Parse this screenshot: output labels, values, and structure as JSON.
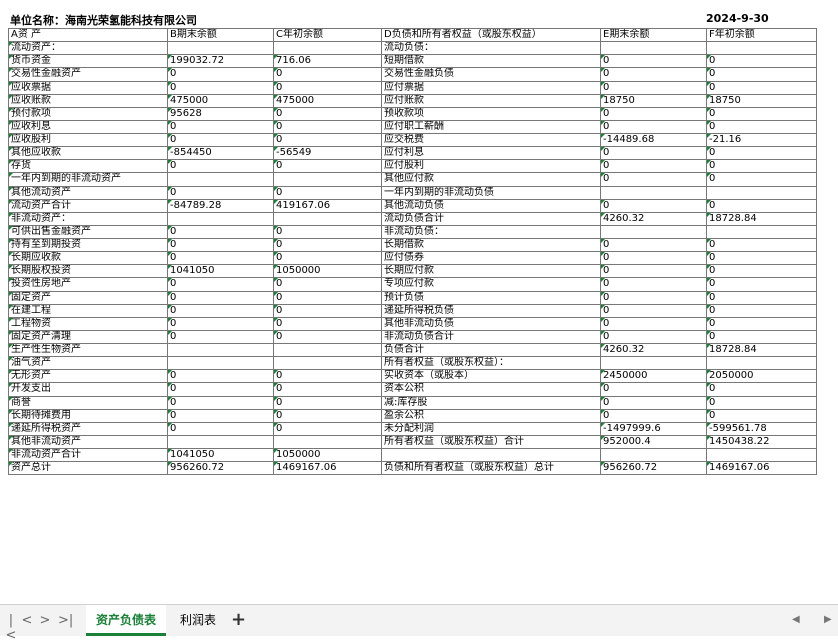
{
  "sheet": {
    "company": "单位名称：海南光荣氢能科技有限公司",
    "date": "2024-9-30",
    "columns": [
      "A资  产",
      "B期末余额",
      "C年初余额",
      "D负债和所有者权益（或股东权益）",
      "E期末余额",
      "F年初余额"
    ],
    "rows": [
      [
        "流动资产：",
        "",
        "",
        "流动负债：",
        "",
        ""
      ],
      [
        "  货币资金",
        "199032.72",
        "716.06",
        "  短期借款",
        "0",
        "0"
      ],
      [
        "  交易性金融资产",
        "0",
        "0",
        "  交易性金融负债",
        "0",
        "0"
      ],
      [
        "  应收票据",
        "0",
        "0",
        "  应付票据",
        "0",
        "0"
      ],
      [
        "  应收账款",
        "475000",
        "475000",
        "  应付账款",
        "18750",
        "18750"
      ],
      [
        "  预付款项",
        "95628",
        "0",
        "  预收款项",
        "0",
        "0"
      ],
      [
        "  应收利息",
        "0",
        "0",
        "  应付职工薪酬",
        "0",
        "0"
      ],
      [
        "  应收股利",
        "0",
        "0",
        "  应交税费",
        "-14489.68",
        "-21.16"
      ],
      [
        "  其他应收款",
        "-854450",
        "-56549",
        "  应付利息",
        "0",
        "0"
      ],
      [
        "  存货",
        "0",
        "0",
        "  应付股利",
        "0",
        "0"
      ],
      [
        "  一年内到期的非流动资产",
        "",
        "",
        "  其他应付款",
        "0",
        "0"
      ],
      [
        "  其他流动资产",
        "0",
        "0",
        "  一年内到期的非流动负债",
        "",
        ""
      ],
      [
        "    流动资产合计",
        "-84789.28",
        "419167.06",
        "  其他流动负债",
        "0",
        "0"
      ],
      [
        "非流动资产：",
        "",
        "",
        "  流动负债合计",
        "4260.32",
        "18728.84"
      ],
      [
        "  可供出售金融资产",
        "0",
        "0",
        "非流动负债：",
        "",
        ""
      ],
      [
        "  持有至到期投资",
        "0",
        "0",
        "  长期借款",
        "0",
        "0"
      ],
      [
        "  长期应收款",
        "0",
        "0",
        "  应付债券",
        "0",
        "0"
      ],
      [
        "  长期股权投资",
        "1041050",
        "1050000",
        "  长期应付款",
        "0",
        "0"
      ],
      [
        "  投资性房地产",
        "0",
        "0",
        "  专项应付款",
        "0",
        "0"
      ],
      [
        "  固定资产",
        "0",
        "0",
        "  预计负债",
        "0",
        "0"
      ],
      [
        "  在建工程",
        "0",
        "0",
        "  递延所得税负债",
        "0",
        "0"
      ],
      [
        "  工程物资",
        "0",
        "0",
        "  其他非流动负债",
        "0",
        "0"
      ],
      [
        "  固定资产清理",
        "0",
        "0",
        "    非流动负债合计",
        "0",
        "0"
      ],
      [
        "  生产性生物资产",
        "",
        "",
        "  负债合计",
        "4260.32",
        "18728.84"
      ],
      [
        "  油气资产",
        "",
        "",
        "所有者权益（或股东权益）：",
        "",
        ""
      ],
      [
        "  无形资产",
        "0",
        "0",
        "  实收资本（或股本）",
        "2450000",
        "2050000"
      ],
      [
        "  开发支出",
        "0",
        "0",
        "  资本公积",
        "0",
        "0"
      ],
      [
        "  商誉",
        "0",
        "0",
        "  减:库存股",
        "0",
        "0"
      ],
      [
        "  长期待摊费用",
        "0",
        "0",
        "  盈余公积",
        "0",
        "0"
      ],
      [
        "  递延所得税资产",
        "0",
        "0",
        "  未分配利润",
        "-1497999.6",
        "-599561.78"
      ],
      [
        "  其他非流动资产",
        "",
        "",
        "  所有者权益（或股东权益）合计",
        "952000.4",
        "1450438.22"
      ],
      [
        "    非流动资产合计",
        "1041050",
        "1050000",
        "",
        "",
        ""
      ],
      [
        "  资产总计",
        "956260.72",
        "1469167.06",
        "负债和所有者权益（或股东权益）总计",
        "956260.72",
        "1469167.06"
      ]
    ]
  },
  "tabs": {
    "nav": [
      "|<",
      "<",
      ">",
      ">|"
    ],
    "items": [
      "资产负债表",
      "利润表"
    ],
    "add": "+"
  },
  "colors": {
    "accent": "#1a7f37",
    "grid": "#777777",
    "tabbar": "#f3f3f3"
  }
}
